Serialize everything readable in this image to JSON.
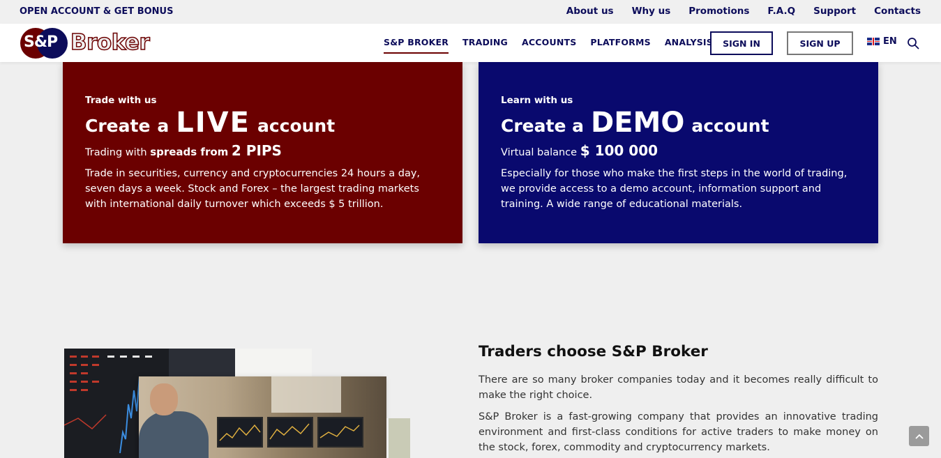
{
  "topbar": {
    "promo": "OPEN ACCOUNT & GET BONUS",
    "links": [
      "About us",
      "Why us",
      "Promotions",
      "F.A.Q",
      "Support",
      "Contacts"
    ]
  },
  "logo": {
    "badge": "S&P",
    "word": "Broker"
  },
  "nav": {
    "items": [
      "S&P BROKER",
      "TRADING",
      "ACCOUNTS",
      "PLATFORMS",
      "ANALYSIS"
    ],
    "active": "S&P BROKER",
    "signin": "SIGN IN",
    "signup": "SIGN UP",
    "lang": "EN"
  },
  "live_card": {
    "eyebrow": "Trade with us",
    "h_pre": "Create",
    "h_mid": "a",
    "h_big": "LIVE",
    "h_post": "account",
    "sub_pre": "Trading with",
    "sub_bold": "spreads from",
    "sub_em": "2 PIPS",
    "desc": "Trade in securities, currency and cryptocurrencies 24 hours a day, seven days a week. Stock and Forex – the largest trading markets with international daily turnover which exceeds $ 5 trillion.",
    "color": "#6b0000"
  },
  "demo_card": {
    "eyebrow": "Learn with us",
    "h_pre": "Create a",
    "h_big": "DEMO",
    "h_post": "account",
    "sub_pre": "Virtual balance",
    "sub_em": "$ 100 000",
    "desc": "Especially for those who make the first steps in the world of trading, we provide access to a demo account, information support and training. A wide range of educational materials.",
    "color": "#09096e"
  },
  "why": {
    "title": "Traders choose S&P Broker",
    "p1": "There are so many broker companies today and it becomes really difficult to make the right choice.",
    "p2": "S&P Broker is a fast-growing company that provides an innovative trading environment and first-class conditions for active traders to make money on the stock, forex, commodity and cryptocurrency markets."
  }
}
